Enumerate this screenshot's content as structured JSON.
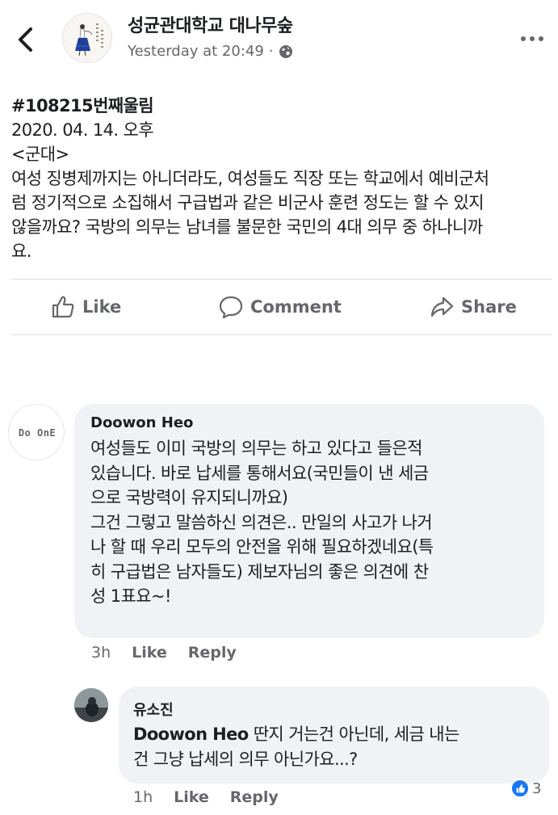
{
  "header": {
    "page_name": "성균관대학교 대나무숲",
    "timestamp": "Yesterday at 20:49",
    "separator": "·",
    "back_icon": "chevron-left-icon",
    "more_icon": "more-dots-icon",
    "privacy_icon": "globe-icon"
  },
  "post": {
    "hashtag": "#108215번째울림",
    "date": "2020. 04. 14. 오후",
    "category": "<군대>",
    "lines": [
      "여성 징병제까지는 아니더라도, 여성들도 직장 또는 학교에서 예비군처",
      "럼 정기적으로 소집해서 구급법과 같은 비군사 훈련 정도는 할 수 있지",
      "않을까요? 국방의 의무는 남녀를 불문한 국민의 4대 의무 중 하나니까",
      "요."
    ]
  },
  "actions": {
    "like_label": "Like",
    "comment_label": "Comment",
    "share_label": "Share"
  },
  "comments": [
    {
      "author": "Doowon Heo",
      "avatar_text": "Do OnE",
      "lines": [
        "여성들도 이미 국방의 의무는 하고 있다고 들은적",
        "있습니다. 바로 납세를 통해서요(국민들이 낸 세금",
        "으로 국방력이 유지되니까요)",
        "그건 그렇고 말씀하신 의견은.. 만일의 사고가 나거",
        "나 할 때 우리 모두의 안전을 위해 필요하겠네요(특",
        "히 구급법은 남자들도) 제보자님의 좋은 의견에 찬",
        "성 1표요~!"
      ],
      "time": "3h",
      "like_label": "Like",
      "reply_label": "Reply"
    },
    {
      "author": "유소진",
      "mention": "Doowon Heo",
      "line1_rest": " 딴지 거는건 아닌데, 세금 내는",
      "line2": "건 그냥 납세의 의무 아닌가요...?",
      "time": "1h",
      "like_label": "Like",
      "reply_label": "Reply",
      "reaction_count": "3"
    }
  ],
  "colors": {
    "text": "#1c1e21",
    "secondary": "#65676b",
    "bubble": "#f0f2f5",
    "like_blue": "#1877f2"
  }
}
